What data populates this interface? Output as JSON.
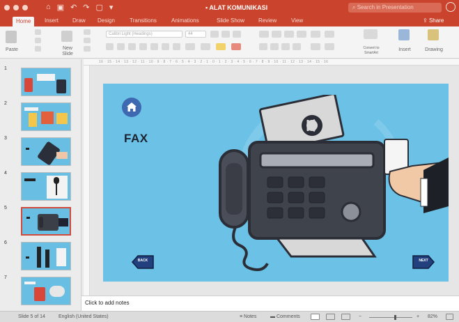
{
  "window": {
    "title": "ALAT KOMUNIKASI",
    "search_placeholder": "Search in Presentation"
  },
  "tabs": [
    "Home",
    "Insert",
    "Draw",
    "Design",
    "Transitions",
    "Animations",
    "Slide Show",
    "Review",
    "View"
  ],
  "share_label": "Share",
  "ribbon": {
    "paste": "Paste",
    "new_slide": "New Slide",
    "font_name": "Calibri Light (Headings)",
    "font_size": "44",
    "convert_smartart": "Convert to SmartArt",
    "insert": "Insert",
    "drawing": "Drawing"
  },
  "ruler_labels": "16 · 15 · 14 · 13 · 12 · 11 · 10 · 9 · 8 · 7 · 6 · 5 · 4 · 3 · 2 · 1 · 0 · 1 · 2 · 3 · 4 · 5 · 6 · 7 · 8 · 9 · 10 · 11 · 12 · 13 · 14 · 15 · 16",
  "thumbnails": [
    {
      "num": "1"
    },
    {
      "num": "2"
    },
    {
      "num": "3"
    },
    {
      "num": "4"
    },
    {
      "num": "5"
    },
    {
      "num": "6"
    },
    {
      "num": "7"
    }
  ],
  "slide": {
    "title": "FAX",
    "back_label": "BACK",
    "next_label": "NEXT"
  },
  "notes_placeholder": "Click to add notes",
  "status": {
    "slide_counter": "Slide 5 of 14",
    "language": "English (United States)",
    "notes": "Notes",
    "comments": "Comments",
    "zoom": "82%"
  },
  "colors": {
    "accent": "#c9432d",
    "slide_bg": "#6cc2e6",
    "nav_button": "#23407e",
    "home_button": "#3e68b0"
  }
}
